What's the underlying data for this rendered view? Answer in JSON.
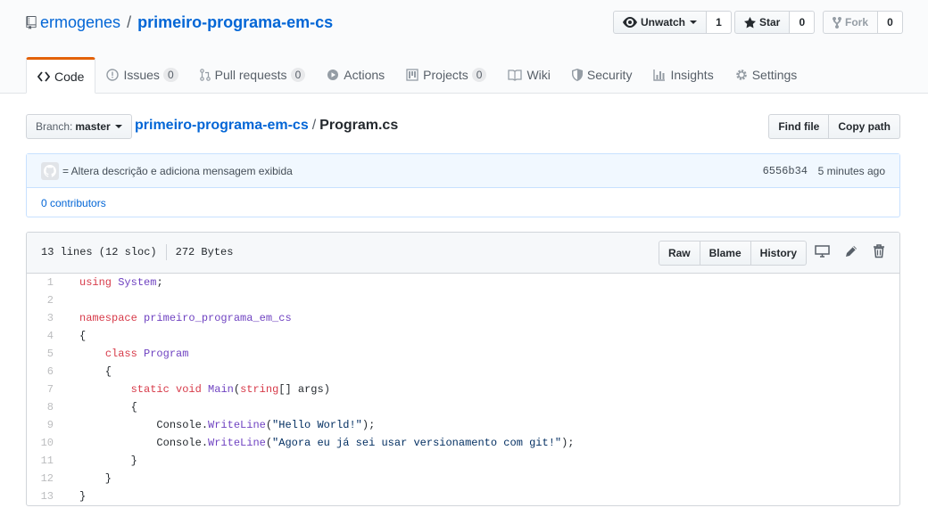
{
  "repo": {
    "owner": "ermogenes",
    "separator": "/",
    "name": "primeiro-programa-em-cs"
  },
  "actions": {
    "watch": {
      "label": "Unwatch",
      "count": "1"
    },
    "star": {
      "label": "Star",
      "count": "0"
    },
    "fork": {
      "label": "Fork",
      "count": "0"
    }
  },
  "tabs": [
    {
      "label": "Code",
      "icon": "code-icon",
      "counter": null,
      "selected": true
    },
    {
      "label": "Issues",
      "icon": "issue-icon",
      "counter": "0"
    },
    {
      "label": "Pull requests",
      "icon": "pull-request-icon",
      "counter": "0"
    },
    {
      "label": "Actions",
      "icon": "play-icon",
      "counter": null
    },
    {
      "label": "Projects",
      "icon": "project-icon",
      "counter": "0"
    },
    {
      "label": "Wiki",
      "icon": "book-icon",
      "counter": null
    },
    {
      "label": "Security",
      "icon": "shield-icon",
      "counter": null
    },
    {
      "label": "Insights",
      "icon": "graph-icon",
      "counter": null
    },
    {
      "label": "Settings",
      "icon": "gear-icon",
      "counter": null
    }
  ],
  "branch": {
    "label": "Branch:",
    "value": "master"
  },
  "breadcrumb": {
    "repo": "primeiro-programa-em-cs",
    "separator": "/",
    "file": "Program.cs"
  },
  "path_buttons": {
    "find_file": "Find file",
    "copy_path": "Copy path"
  },
  "commit": {
    "message": "= Altera descrição e adiciona mensagem exibida",
    "sha": "6556b34",
    "time": "5 minutes ago",
    "contributors": "0 contributors"
  },
  "file": {
    "lines_info": "13 lines (12 sloc)",
    "size": "272 Bytes",
    "buttons": {
      "raw": "Raw",
      "blame": "Blame",
      "history": "History"
    }
  },
  "code": [
    {
      "n": "1",
      "tokens": [
        [
          "kw",
          "using"
        ],
        [
          "",
          " "
        ],
        [
          "en",
          "System"
        ],
        [
          "",
          ";"
        ]
      ]
    },
    {
      "n": "2",
      "tokens": []
    },
    {
      "n": "3",
      "tokens": [
        [
          "kw",
          "namespace"
        ],
        [
          "",
          " "
        ],
        [
          "en",
          "primeiro_programa_em_cs"
        ]
      ]
    },
    {
      "n": "4",
      "tokens": [
        [
          "",
          "{"
        ]
      ]
    },
    {
      "n": "5",
      "tokens": [
        [
          "",
          "    "
        ],
        [
          "kw",
          "class"
        ],
        [
          "",
          " "
        ],
        [
          "en",
          "Program"
        ]
      ]
    },
    {
      "n": "6",
      "tokens": [
        [
          "",
          "    {"
        ]
      ]
    },
    {
      "n": "7",
      "tokens": [
        [
          "",
          "        "
        ],
        [
          "kw",
          "static"
        ],
        [
          "",
          " "
        ],
        [
          "kw",
          "void"
        ],
        [
          "",
          " "
        ],
        [
          "en",
          "Main"
        ],
        [
          "",
          "("
        ],
        [
          "kw",
          "string"
        ],
        [
          "",
          "[] args)"
        ]
      ]
    },
    {
      "n": "8",
      "tokens": [
        [
          "",
          "        {"
        ]
      ]
    },
    {
      "n": "9",
      "tokens": [
        [
          "",
          "            Console."
        ],
        [
          "en",
          "WriteLine"
        ],
        [
          "",
          "("
        ],
        [
          "str",
          "\"Hello World!\""
        ],
        [
          "",
          ");"
        ]
      ]
    },
    {
      "n": "10",
      "tokens": [
        [
          "",
          "            Console."
        ],
        [
          "en",
          "WriteLine"
        ],
        [
          "",
          "("
        ],
        [
          "str",
          "\"Agora eu já sei usar versionamento com git!\""
        ],
        [
          "",
          ");"
        ]
      ]
    },
    {
      "n": "11",
      "tokens": [
        [
          "",
          "        }"
        ]
      ]
    },
    {
      "n": "12",
      "tokens": [
        [
          "",
          "    }"
        ]
      ]
    },
    {
      "n": "13",
      "tokens": [
        [
          "",
          "}"
        ]
      ]
    }
  ],
  "colors": {
    "link": "#0366d6",
    "tab_accent": "#e36209",
    "keyword": "#d73a49",
    "entity": "#6f42c1",
    "string": "#032f62"
  }
}
